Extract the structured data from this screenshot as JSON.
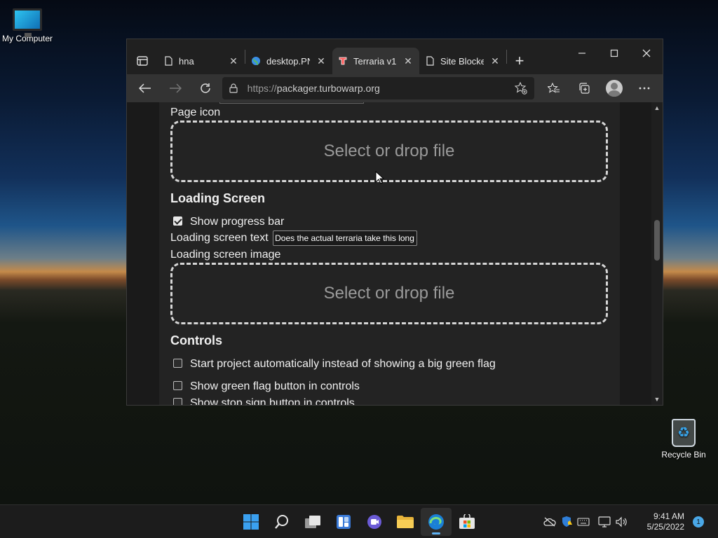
{
  "desktop": {
    "icons": [
      {
        "label": "My Computer",
        "icon": "monitor-icon"
      },
      {
        "label": "Recycle Bin",
        "icon": "recycle-bin-icon"
      }
    ]
  },
  "browser": {
    "tabs": [
      {
        "label": "hna",
        "icon": "page-icon",
        "close": "✕"
      },
      {
        "label": "desktop.PNG",
        "icon": "globe-icon",
        "close": "✕"
      },
      {
        "label": "Terraria v1",
        "icon": "turbowarp-icon",
        "close": "✕",
        "active": true
      },
      {
        "label": "Site Blocker",
        "icon": "page-icon",
        "close": "✕"
      }
    ],
    "new_tab_label": "+",
    "url_protocol": "https://",
    "url_host": "packager.turbowarp.org"
  },
  "page": {
    "page_icon_label": "Page icon",
    "dropzone_label": "Select or drop file",
    "loading_heading": "Loading Screen",
    "show_progress_bar_label": "Show progress bar",
    "show_progress_bar_checked": true,
    "loading_text_label": "Loading screen text",
    "loading_text_value": "Does the actual terraria take this long",
    "loading_image_label": "Loading screen image",
    "controls_heading": "Controls",
    "controls": [
      {
        "label": "Start project automatically instead of showing a big green flag",
        "checked": false
      },
      {
        "label": "Show green flag button in controls",
        "checked": false
      },
      {
        "label": "Show stop sign button in controls",
        "checked": false
      }
    ]
  },
  "taskbar": {
    "time": "9:41 AM",
    "date": "5/25/2022",
    "notification_count": "1"
  },
  "colors": {
    "accent": "#5fb2f2",
    "page_bg": "#232323",
    "chrome_bg": "#202020"
  }
}
